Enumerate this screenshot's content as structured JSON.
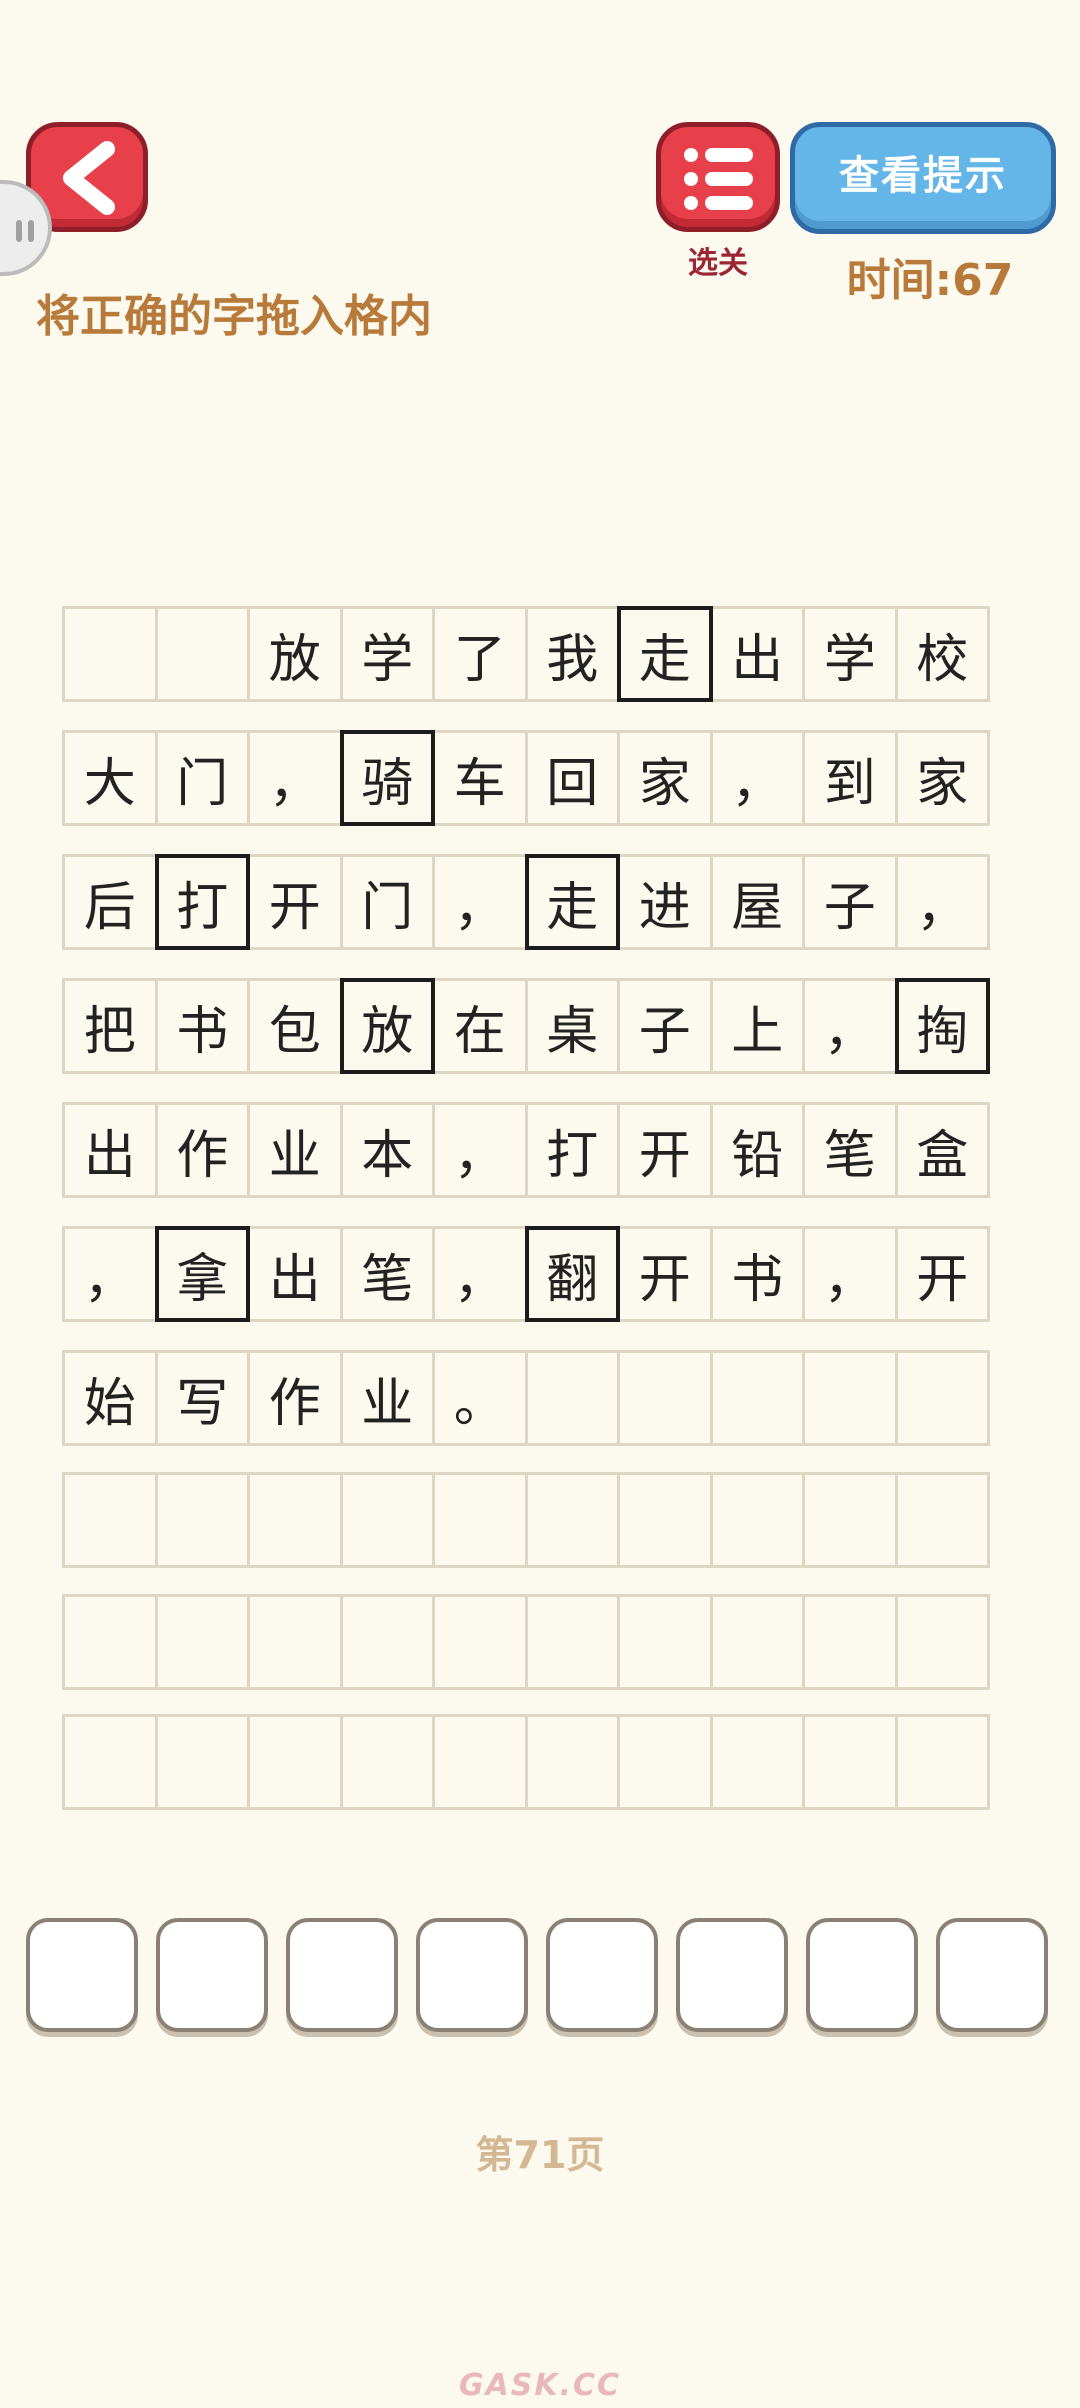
{
  "header": {
    "menu_label": "选关",
    "hint_button_label": "查看提示",
    "timer_label": "时间:67"
  },
  "instruction": "将正确的字拖入格内",
  "grid": {
    "rows": [
      {
        "cells": [
          {
            "ch": ""
          },
          {
            "ch": ""
          },
          {
            "ch": "放"
          },
          {
            "ch": "学"
          },
          {
            "ch": "了"
          },
          {
            "ch": "我"
          },
          {
            "ch": "走",
            "answer": true
          },
          {
            "ch": "出"
          },
          {
            "ch": "学"
          },
          {
            "ch": "校"
          }
        ]
      },
      {
        "cells": [
          {
            "ch": "大"
          },
          {
            "ch": "门"
          },
          {
            "ch": "，"
          },
          {
            "ch": "骑",
            "answer": true
          },
          {
            "ch": "车"
          },
          {
            "ch": "回"
          },
          {
            "ch": "家"
          },
          {
            "ch": "，"
          },
          {
            "ch": "到"
          },
          {
            "ch": "家"
          }
        ]
      },
      {
        "cells": [
          {
            "ch": "后"
          },
          {
            "ch": "打",
            "answer": true
          },
          {
            "ch": "开"
          },
          {
            "ch": "门"
          },
          {
            "ch": "，"
          },
          {
            "ch": "走",
            "answer": true
          },
          {
            "ch": "进"
          },
          {
            "ch": "屋"
          },
          {
            "ch": "子"
          },
          {
            "ch": "，"
          }
        ]
      },
      {
        "cells": [
          {
            "ch": "把"
          },
          {
            "ch": "书"
          },
          {
            "ch": "包"
          },
          {
            "ch": "放",
            "answer": true
          },
          {
            "ch": "在"
          },
          {
            "ch": "桌"
          },
          {
            "ch": "子"
          },
          {
            "ch": "上"
          },
          {
            "ch": "，"
          },
          {
            "ch": "掏",
            "answer": true
          }
        ]
      },
      {
        "cells": [
          {
            "ch": "出"
          },
          {
            "ch": "作"
          },
          {
            "ch": "业"
          },
          {
            "ch": "本"
          },
          {
            "ch": "，"
          },
          {
            "ch": "打"
          },
          {
            "ch": "开"
          },
          {
            "ch": "铅"
          },
          {
            "ch": "笔"
          },
          {
            "ch": "盒"
          }
        ]
      },
      {
        "cells": [
          {
            "ch": "，"
          },
          {
            "ch": "拿",
            "answer": true
          },
          {
            "ch": "出"
          },
          {
            "ch": "笔"
          },
          {
            "ch": "，"
          },
          {
            "ch": "翻",
            "answer": true
          },
          {
            "ch": "开"
          },
          {
            "ch": "书"
          },
          {
            "ch": "，"
          },
          {
            "ch": "开"
          }
        ]
      },
      {
        "cells": [
          {
            "ch": "始"
          },
          {
            "ch": "写"
          },
          {
            "ch": "作"
          },
          {
            "ch": "业"
          },
          {
            "ch": "。"
          },
          {
            "ch": ""
          },
          {
            "ch": ""
          },
          {
            "ch": ""
          },
          {
            "ch": ""
          },
          {
            "ch": ""
          }
        ]
      },
      {
        "cells": [
          {
            "ch": ""
          },
          {
            "ch": ""
          },
          {
            "ch": ""
          },
          {
            "ch": ""
          },
          {
            "ch": ""
          },
          {
            "ch": ""
          },
          {
            "ch": ""
          },
          {
            "ch": ""
          },
          {
            "ch": ""
          },
          {
            "ch": ""
          }
        ]
      },
      {
        "cells": [
          {
            "ch": ""
          },
          {
            "ch": ""
          },
          {
            "ch": ""
          },
          {
            "ch": ""
          },
          {
            "ch": ""
          },
          {
            "ch": ""
          },
          {
            "ch": ""
          },
          {
            "ch": ""
          },
          {
            "ch": ""
          },
          {
            "ch": ""
          }
        ]
      },
      {
        "cells": [
          {
            "ch": ""
          },
          {
            "ch": ""
          },
          {
            "ch": ""
          },
          {
            "ch": ""
          },
          {
            "ch": ""
          },
          {
            "ch": ""
          },
          {
            "ch": ""
          },
          {
            "ch": ""
          },
          {
            "ch": ""
          },
          {
            "ch": ""
          }
        ]
      }
    ]
  },
  "tiles": [
    {
      "ch": ""
    },
    {
      "ch": ""
    },
    {
      "ch": ""
    },
    {
      "ch": ""
    },
    {
      "ch": ""
    },
    {
      "ch": ""
    },
    {
      "ch": ""
    },
    {
      "ch": ""
    }
  ],
  "page_label": "第71页",
  "watermark": "GASK.CC",
  "colors": {
    "background": "#fcf9ee",
    "button_red": "#e8404a",
    "button_blue": "#64b5e8",
    "accent_brown": "#b87a3a"
  }
}
